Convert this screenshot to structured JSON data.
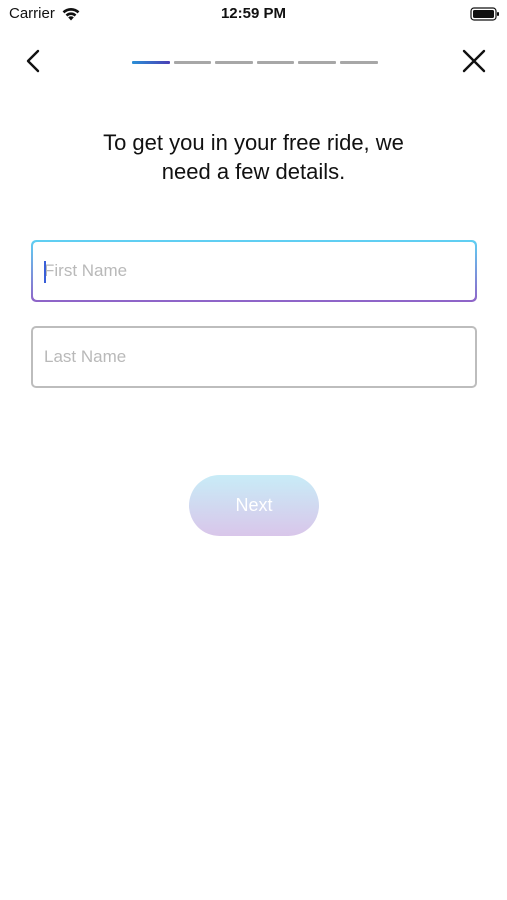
{
  "status_bar": {
    "carrier": "Carrier",
    "time": "12:59 PM",
    "wifi_icon": "wifi-icon",
    "battery_icon": "battery-icon"
  },
  "nav": {
    "back_icon": "chevron-left-icon",
    "close_icon": "close-icon",
    "progress": {
      "total_steps": 6,
      "current_step": 1,
      "active_color": "#3a6fd0",
      "inactive_color": "#a7a7a7"
    }
  },
  "form": {
    "heading_line1": "To get you in your free ride, we",
    "heading_line2": "need a few details.",
    "first_name": {
      "placeholder": "First Name",
      "value": ""
    },
    "last_name": {
      "placeholder": "Last Name",
      "value": ""
    },
    "next_label": "Next"
  },
  "colors": {
    "focus_border_top": "#5fd0f3",
    "focus_border_bottom": "#8f63c8",
    "button_gradient_top": "#c8ecf7",
    "button_gradient_bottom": "#d9c6ea"
  }
}
